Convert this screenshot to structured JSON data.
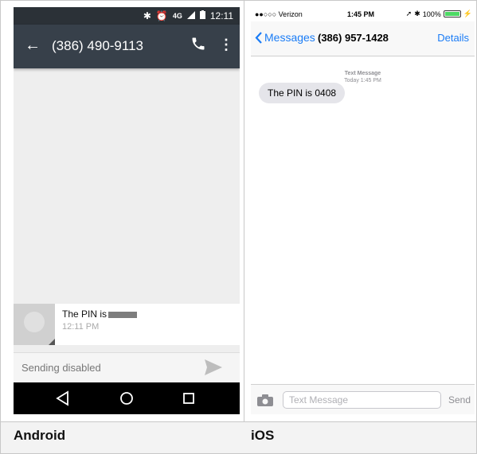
{
  "android": {
    "status_time": "12:11",
    "network_label": "4G",
    "toolbar_number": "(386) 490-9113",
    "message_text": "The PIN is",
    "message_time": "12:11 PM",
    "compose_placeholder": "Sending disabled",
    "caption": "Android",
    "colors": {
      "toolbar": "#37404a",
      "statusbar": "#2b3137",
      "navbar": "#000000"
    }
  },
  "ios": {
    "carrier": "●●○○○ Verizon",
    "status_time": "1:45 PM",
    "battery": "100%",
    "back_label": "Messages",
    "title_number": "(386) 957-1428",
    "details_label": "Details",
    "meta_type": "Text Message",
    "meta_time": "Today 1:45 PM",
    "message_text": "The PIN is 0408",
    "input_placeholder": "Text Message",
    "send_label": "Send",
    "caption": "iOS",
    "colors": {
      "accent": "#1a7cf6",
      "bubble": "#e5e5ea",
      "battery": "#4cd964"
    }
  }
}
